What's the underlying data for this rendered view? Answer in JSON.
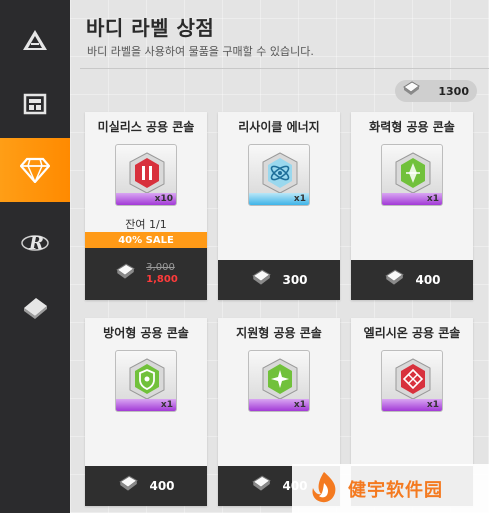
{
  "sidebar": {
    "items": [
      {
        "name": "pyramid-icon",
        "active": false
      },
      {
        "name": "shop-icon",
        "active": false
      },
      {
        "name": "gem-icon",
        "active": true
      },
      {
        "name": "r-emblem-icon",
        "active": false
      },
      {
        "name": "card-stack-icon",
        "active": false
      }
    ]
  },
  "header": {
    "title": "바디 라벨 상점",
    "subtitle": "바디 라벨을 사용하여 물품을 구매할 수 있습니다."
  },
  "currency": {
    "icon": "label-token-icon",
    "amount": "1300"
  },
  "shop": {
    "items": [
      {
        "name": "미실리스 공용 콘솔",
        "qty": "x10",
        "remain": "잔여 1/1",
        "sale_label": "40% SALE",
        "old_price": "3,000",
        "price": "1,800",
        "bar_color": "#a23ad6",
        "gem_color": "#d8313d"
      },
      {
        "name": "리사이클 에너지",
        "qty": "x1",
        "price": "300",
        "bar_color": "#3fb4e8",
        "gem_color": "#69c9e6"
      },
      {
        "name": "화력형 공용 콘솔",
        "qty": "x1",
        "price": "400",
        "bar_color": "#a23ad6",
        "gem_color": "#71c13b"
      },
      {
        "name": "방어형 공용 콘솔",
        "qty": "x1",
        "price": "400",
        "bar_color": "#a23ad6",
        "gem_color": "#71c13b"
      },
      {
        "name": "지원형 공용 콘솔",
        "qty": "x1",
        "price": "400",
        "bar_color": "#a23ad6",
        "gem_color": "#71c13b"
      },
      {
        "name": "엘리시온 공용 콘솔",
        "qty": "x1",
        "price": "",
        "bar_color": "#a23ad6",
        "gem_color": "#d8313d"
      }
    ]
  },
  "watermark": {
    "text": "健宇软件园"
  },
  "colors": {
    "accent": "#ff8a00",
    "sale": "#ff9a17",
    "sale_price": "#ff3b3b"
  }
}
